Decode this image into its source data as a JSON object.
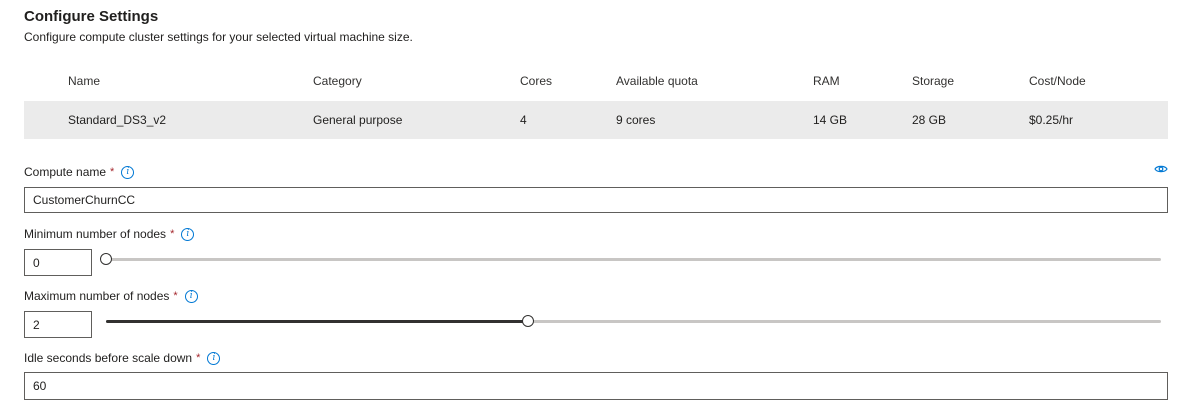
{
  "header": {
    "title": "Configure Settings",
    "subtitle": "Configure compute cluster settings for your selected virtual machine size."
  },
  "vm_table": {
    "columns": [
      "Name",
      "Category",
      "Cores",
      "Available quota",
      "RAM",
      "Storage",
      "Cost/Node"
    ],
    "row": [
      "Standard_DS3_v2",
      "General purpose",
      "4",
      "9 cores",
      "14 GB",
      "28 GB",
      "$0.25/hr"
    ]
  },
  "fields": {
    "compute_name": {
      "label": "Compute name",
      "required_mark": "*",
      "value": "CustomerChurnCC"
    },
    "min_nodes": {
      "label": "Minimum number of nodes",
      "required_mark": "*",
      "value": "0"
    },
    "max_nodes": {
      "label": "Maximum number of nodes",
      "required_mark": "*",
      "value": "2"
    },
    "idle_seconds": {
      "label": "Idle seconds before scale down",
      "required_mark": "*",
      "value": "60"
    }
  },
  "icons": {
    "info": "info-icon",
    "view": "eye-icon"
  },
  "sliders": {
    "min_nodes_fraction": 0.0,
    "max_nodes_fraction": 0.4
  },
  "colors": {
    "accent": "#0078d4",
    "required": "#a4262c",
    "row_highlight": "#ebebeb"
  }
}
